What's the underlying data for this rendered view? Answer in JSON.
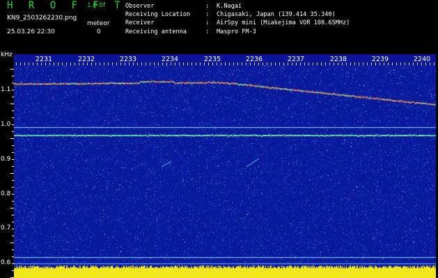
{
  "header": {
    "brand": "H R O F F T",
    "version": "1.0.0f",
    "filename": "KN9_2503262230.png",
    "meteor_label": "meteor",
    "meteor_count": "0",
    "timestamp": "25.03.26 22:30"
  },
  "info": [
    {
      "key": "Observer",
      "sep": ":",
      "value": "K.Nagai"
    },
    {
      "key": "Receiving Location",
      "sep": ":",
      "value": "Chigasaki, Japan (139.414 35.340)"
    },
    {
      "key": "Receiver",
      "sep": ":",
      "value": "AirSpy mini (Miakejima VOR 108.65MHz)"
    },
    {
      "key": "Receiving antenna",
      "sep": ":",
      "value": "Maspro FM-3"
    }
  ],
  "axis": {
    "unit": "kHz",
    "time_labels": [
      "2231",
      "2232",
      "2233",
      "2234",
      "2235",
      "2236",
      "2237",
      "2238",
      "2239",
      "2240"
    ],
    "freq_labels": [
      "1.1",
      "1.0",
      "0.9",
      "0.8",
      "0.7",
      "0.6"
    ]
  },
  "colors": {
    "brand_green": "#22e03a",
    "spectrogram_bg": "#0a1a9c",
    "baseline_yellow": "#f2e61c"
  }
}
